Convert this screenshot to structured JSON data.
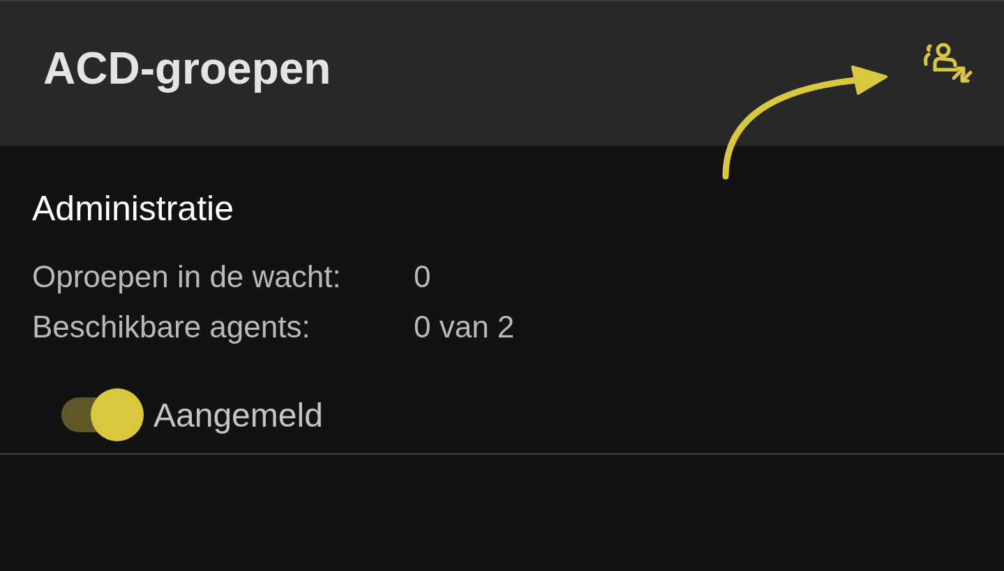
{
  "app_bar": {
    "title": "ACD-groepen"
  },
  "groups": [
    {
      "name": "Administratie",
      "stats": [
        {
          "label": "Oproepen in de wacht:",
          "value": "0"
        },
        {
          "label": "Beschikbare agents:",
          "value": "0 van 2"
        }
      ],
      "toggle": {
        "label": "Aangemeld",
        "on": true
      }
    }
  ]
}
